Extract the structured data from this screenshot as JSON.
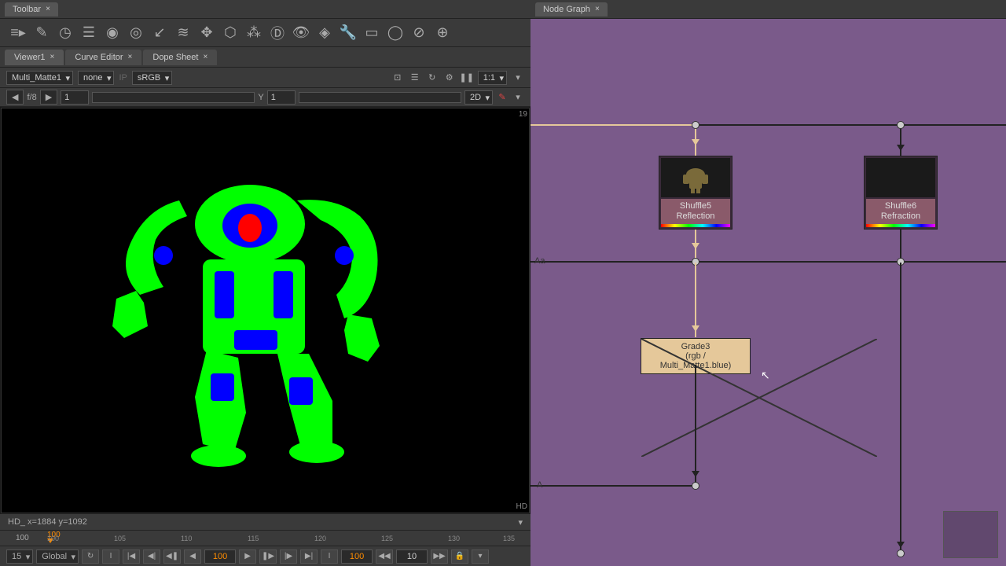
{
  "toolbar_tab": "Toolbar",
  "viewer_tabs": {
    "viewer": "Viewer1",
    "curve": "Curve Editor",
    "dope": "Dope Sheet"
  },
  "viewer_controls": {
    "channel": "Multi_Matte1",
    "layer": "none",
    "ip": "IP",
    "colorspace": "sRGB",
    "zoom": "1:1"
  },
  "frame": {
    "label": "f/8",
    "f": "1",
    "y_label": "Y",
    "y": "1",
    "mode": "2D"
  },
  "viewer": {
    "corner_num": "19",
    "hd": "HD"
  },
  "status": {
    "text": "HD_ x=1884 y=1092"
  },
  "timeline": {
    "cur": "100",
    "marker": "100",
    "ticks": [
      "100",
      "105",
      "110",
      "115",
      "120",
      "125",
      "130",
      "135"
    ]
  },
  "playback": {
    "fps": "15",
    "mode": "Global",
    "frame": "100",
    "in": "100",
    "step": "10"
  },
  "nodegraph_tab": "Node Graph",
  "nodes": {
    "shuffle5": {
      "name": "Shuffle5",
      "sub": "Reflection"
    },
    "shuffle6": {
      "name": "Shuffle6",
      "sub": "Refraction"
    },
    "grade": {
      "name": "Grade3",
      "sub": "(rgb / Multi_Matte1.blue)"
    }
  },
  "tags": {
    "aa": "Aa",
    "a": "A"
  }
}
